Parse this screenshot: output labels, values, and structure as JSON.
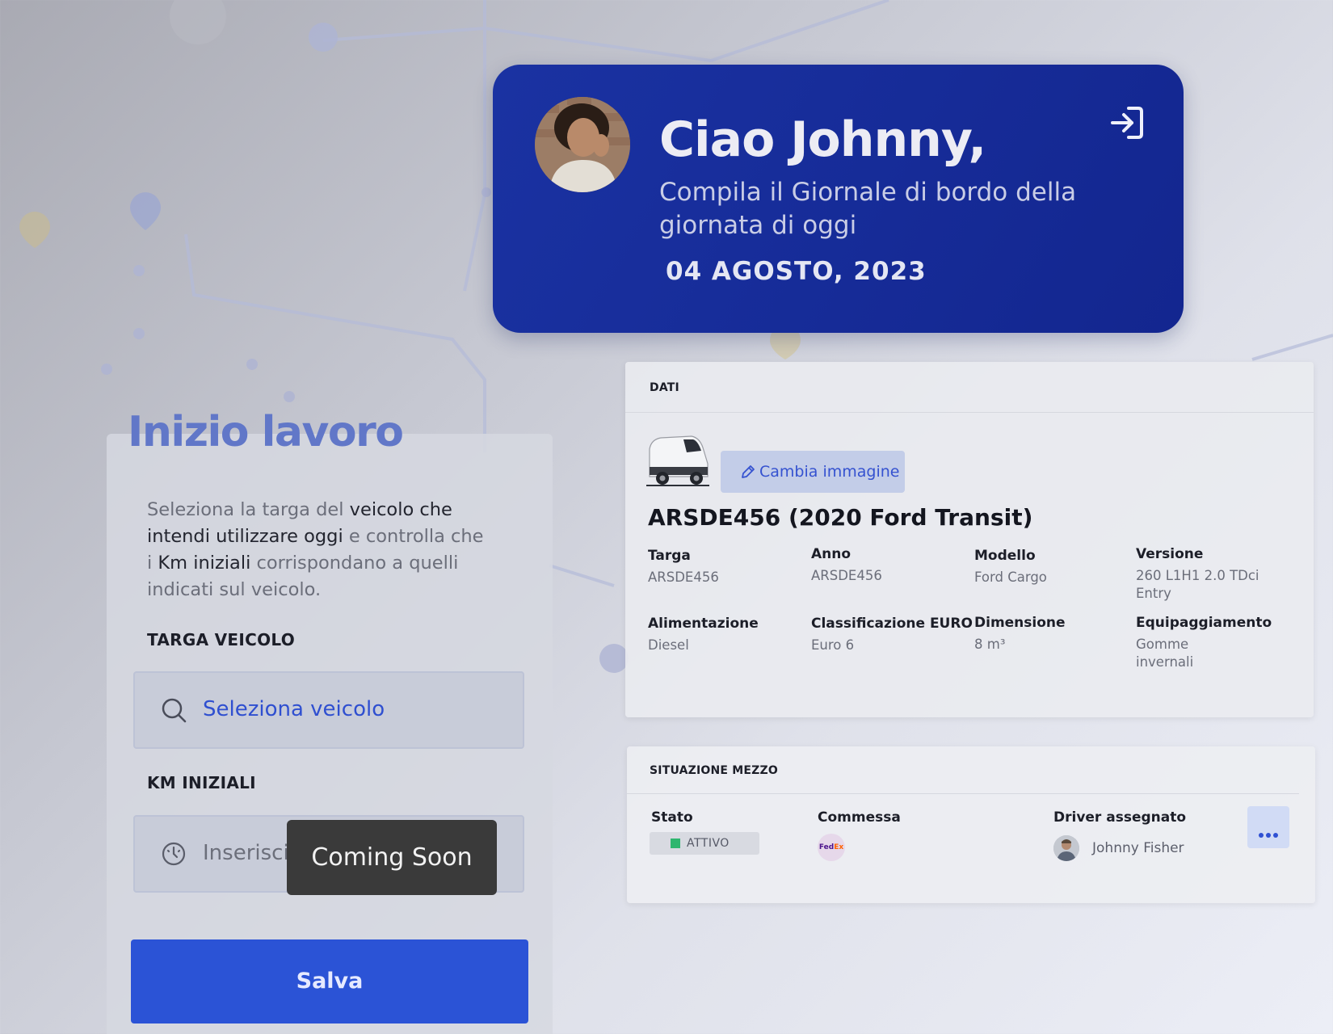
{
  "greeting": {
    "title": "Ciao Johnny,",
    "subtitle": "Compila il Giornale di bordo della giornata di oggi",
    "date": "04 AGOSTO, 2023"
  },
  "start_work": {
    "title": "Inizio lavoro",
    "intro_parts": [
      "Seleziona la targa del ",
      "veicolo che intendi utilizzare oggi",
      " e controlla che i ",
      "Km iniziali",
      " corrispondano a quelli indicati sul veicolo."
    ],
    "plate_label": "TARGA VEICOLO",
    "plate_placeholder": "Seleziona veicolo",
    "km_label": "KM INIZIALI",
    "km_placeholder": "Inserisci km",
    "tooltip": "Coming Soon",
    "save_label": "Salva"
  },
  "dati": {
    "header": "DATI",
    "change_image_label": "Cambia immagine",
    "vehicle_title": "ARSDE456 (2020 Ford Transit)",
    "specs": [
      {
        "key": "Targa",
        "value": "ARSDE456"
      },
      {
        "key": "Anno",
        "value": "ARSDE456"
      },
      {
        "key": "Modello",
        "value": "Ford Cargo"
      },
      {
        "key": "Versione",
        "value": "260 L1H1 2.0 TDci Entry"
      },
      {
        "key": "Alimentazione",
        "value": "Diesel"
      },
      {
        "key": "Classificazione EURO",
        "value": "Euro 6"
      },
      {
        "key": "Dimensione",
        "value": "8 m³"
      },
      {
        "key": "Equipaggiamento",
        "value": "Gomme invernali"
      }
    ]
  },
  "situazione": {
    "header": "SITUAZIONE MEZZO",
    "stato_label": "Stato",
    "stato_value": "ATTIVO",
    "stato_color": "#2fb66f",
    "commessa_label": "Commessa",
    "commessa_logo_fe": "Fed",
    "commessa_logo_ex": "Ex",
    "driver_label": "Driver assegnato",
    "driver_name": "Johnny Fisher"
  },
  "colors": {
    "greeting_bg": "#1a32a2",
    "accent": "#2b53d6",
    "title_accent": "#6177c8"
  }
}
